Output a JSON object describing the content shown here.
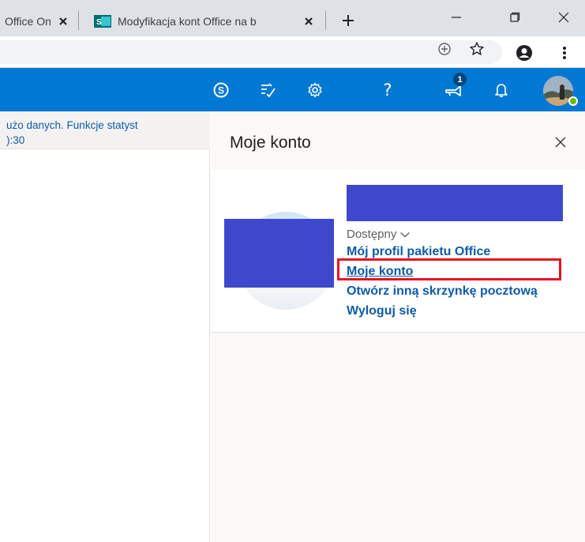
{
  "browser": {
    "tabs": [
      {
        "title": "Office Online"
      },
      {
        "title": "Modyfikacja kont Office na b"
      }
    ],
    "new_tab_symbol": "+",
    "icons": {
      "zoom": "zoom-icon",
      "bookmark": "star-icon",
      "profile": "profile-icon",
      "menu": "kebab-menu-icon"
    }
  },
  "header": {
    "accent_color": "#0078d4",
    "buttons": [
      "skype-icon",
      "todo-icon",
      "gear-icon",
      "help-icon",
      "megaphone-icon",
      "bell-icon"
    ],
    "help_glyph": "?",
    "whats_new_badge": "1"
  },
  "message_list": {
    "preview_text": "użo danych. Funkcje statyst",
    "time_text": "):30"
  },
  "account_panel": {
    "title": "Moje konto",
    "status": "Dostępny",
    "links": {
      "profile": "Mój profil pakietu Office",
      "my_account": "Moje konto",
      "open_other_mailbox": "Otwórz inną skrzynkę pocztową",
      "sign_out": "Wyloguj się"
    },
    "redaction_color": "#3f48cc",
    "highlight_color": "#e81123"
  }
}
